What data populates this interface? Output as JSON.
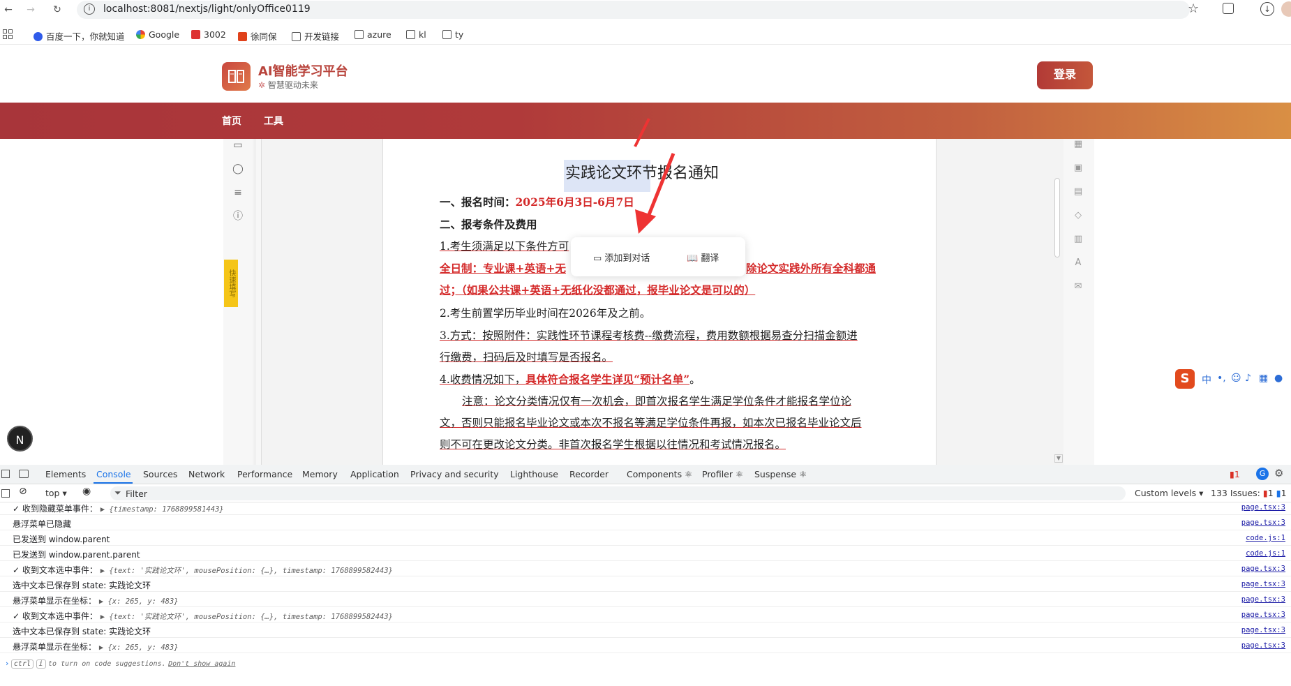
{
  "browser": {
    "url": "localhost:8081/nextjs/light/onlyOffice0119",
    "bookmarks": [
      "百度一下，你就知道",
      "Google",
      "3002",
      "徐同保",
      "开发链接",
      "azure",
      "kl",
      "ty"
    ]
  },
  "site": {
    "title": "AI智能学习平台",
    "subtitle": "智慧驱动未来",
    "login": "登录",
    "nav": [
      "首页",
      "工具"
    ]
  },
  "editor": {
    "yellow_tab": "快速填写",
    "doc_title": "实践论文环节报名通知",
    "lines": {
      "l1a": "一、报名时间：",
      "l1b": "2025年6月3日-6月7日",
      "l2": "二、报考条件及费用",
      "l3": "1.考生须满足以下条件方可",
      "l4a": "全日制：专业课+英语+无",
      "l4b": "除论文实践外所有全科都通",
      "l5": "过；（如果公共课+英语+无纸化没都通过，报毕业论文是可以的）",
      "l6": "2.考生前置学历毕业时间在2026年及之前。",
      "l7": "3.方式：按照附件：实践性环节课程考核费--缴费流程，费用数额根据易查分扫描金额进",
      "l8": "行缴费，扫码后及时填写是否报名。",
      "l9a": "4.收费情况如下，",
      "l9b": "具体符合报名学生详见“预计名单”",
      "l9c": "。",
      "l10": "注意：论文分类情况仅有一次机会，即首次报名学生满足学位条件才能报名学位论",
      "l11": "文，否则只能报名毕业论文或本次不报名等满足学位条件再报，如本次已报名毕业论文后",
      "l12": "则不可在更改论文分类。非首次报名学生根据以往情况和考试情况报名。"
    },
    "popup": {
      "add_to_chat": "添加到对话",
      "translate": "翻译"
    }
  },
  "avatar_letter": "N",
  "devtools": {
    "tabs": [
      "Elements",
      "Console",
      "Sources",
      "Network",
      "Performance",
      "Memory",
      "Application",
      "Privacy and security",
      "Lighthouse",
      "Recorder",
      "Components ⚛",
      "Profiler ⚛",
      "Suspense ⚛"
    ],
    "context": "top",
    "filter_placeholder": "Filter",
    "levels": "Custom levels",
    "issues": "133 Issues:",
    "issue_count_a": "1",
    "issue_count_b": "1",
    "issue_badge": "1",
    "logs": [
      {
        "msg": "✓ 收到隐藏菜单事件：",
        "obj": "▶ {timestamp: 1768899581443}",
        "src": "page.tsx:3"
      },
      {
        "msg": "悬浮菜单已隐藏",
        "obj": "",
        "src": "page.tsx:3"
      },
      {
        "msg": "已发送到 window.parent",
        "obj": "",
        "src": "code.js:1"
      },
      {
        "msg": "已发送到 window.parent.parent",
        "obj": "",
        "src": "code.js:1"
      },
      {
        "msg": "✓ 收到文本选中事件：",
        "obj": "▶ {text: '实践论文环', mousePosition: {…}, timestamp: 1768899582443}",
        "src": "page.tsx:3"
      },
      {
        "msg": "选中文本已保存到 state: 实践论文环",
        "obj": "",
        "src": "page.tsx:3"
      },
      {
        "msg": "悬浮菜单显示在坐标：",
        "obj": "▶ {x: 265, y: 483}",
        "src": "page.tsx:3"
      },
      {
        "msg": "✓ 收到文本选中事件：",
        "obj": "▶ {text: '实践论文环', mousePosition: {…}, timestamp: 1768899582443}",
        "src": "page.tsx:3"
      },
      {
        "msg": "选中文本已保存到 state: 实践论文环",
        "obj": "",
        "src": "page.tsx:3"
      },
      {
        "msg": "悬浮菜单显示在坐标：",
        "obj": "▶ {x: 265, y: 483}",
        "src": "page.tsx:3"
      }
    ],
    "prompt": {
      "k1": "ctrl",
      "k2": "i",
      "text": "to turn on code suggestions.",
      "link": "Don't show again"
    }
  }
}
